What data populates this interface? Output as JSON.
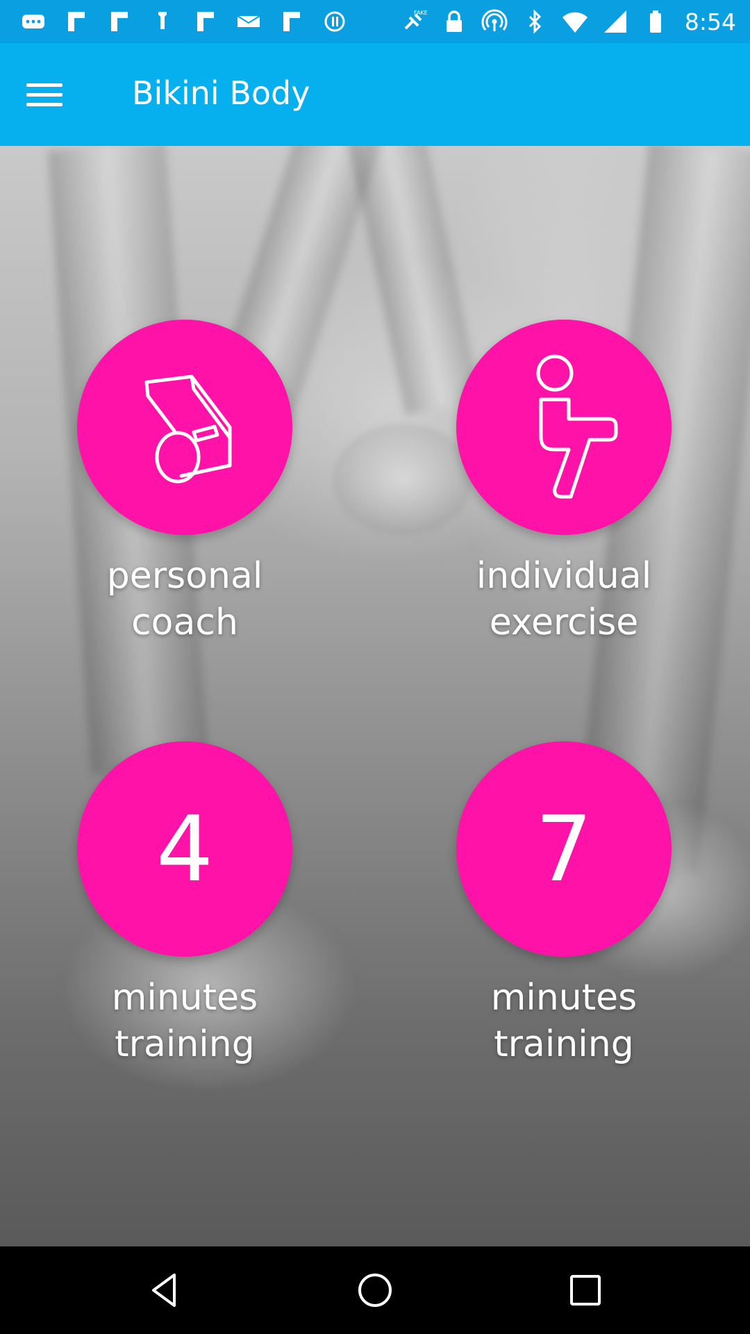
{
  "status_bar": {
    "time": "8:54",
    "left_icons": [
      "messaging-icon",
      "flipboard-icon",
      "flipboard-icon",
      "settings-app-icon",
      "flipboard-icon",
      "email-icon",
      "flipboard-icon",
      "media-icon"
    ],
    "right_icons": [
      "gps-fake-icon",
      "lock-icon",
      "hotspot-icon",
      "bluetooth-icon",
      "wifi-icon",
      "signal-icon",
      "battery-icon"
    ]
  },
  "app_bar": {
    "title": "Bikini Body",
    "menu_icon": "hamburger-menu-icon",
    "color": "#06b0ee"
  },
  "tiles": [
    {
      "icon": "whistle-icon",
      "line1": "personal",
      "line2": "coach"
    },
    {
      "icon": "sitting-person-icon",
      "line1": "individual",
      "line2": "exercise"
    },
    {
      "number": "4",
      "line1": "minutes",
      "line2": "training"
    },
    {
      "number": "7",
      "line1": "minutes",
      "line2": "training"
    }
  ],
  "accent_color": "#ff12a7",
  "nav_bar": {
    "buttons": [
      "back-icon",
      "home-icon",
      "recents-icon"
    ]
  }
}
